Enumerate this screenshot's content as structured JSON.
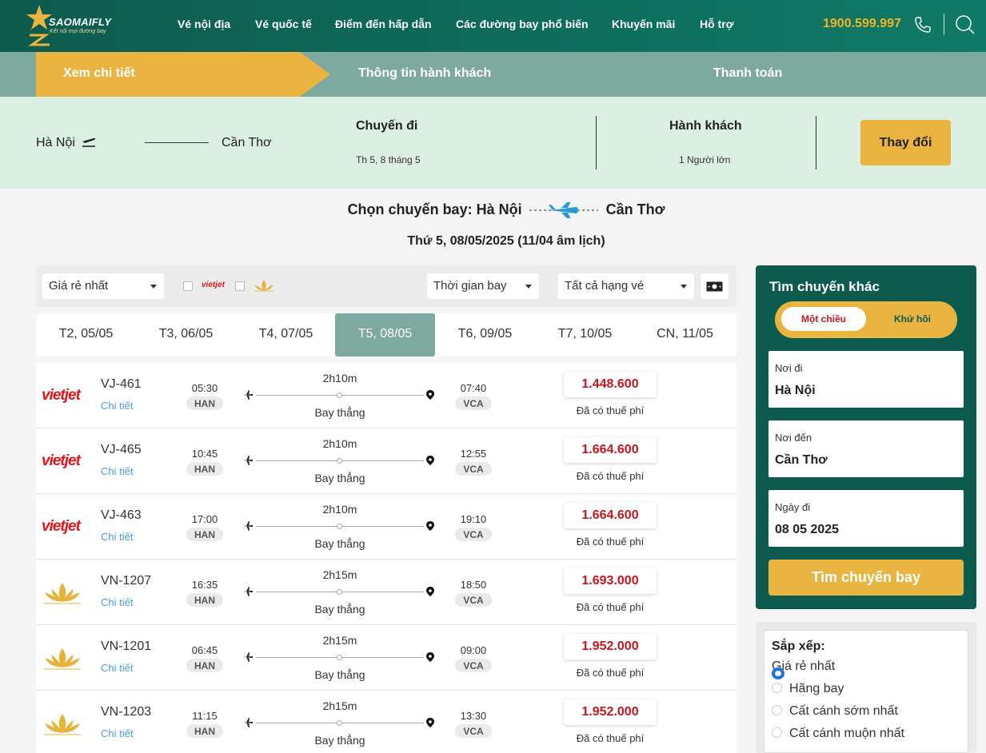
{
  "header": {
    "brand": "SAOMAIFLY",
    "slogan": "Kết nối mọi đường bay",
    "nav": [
      "Vé nội địa",
      "Vé quốc tế",
      "Điểm đến hấp dẫn",
      "Các đường bay phổ biến",
      "Khuyến mãi",
      "Hỗ trợ"
    ],
    "hotline": "1900.599.997"
  },
  "steps": [
    "Xem chi tiết",
    "Thông tin hành khách",
    "Thanh toán"
  ],
  "summary": {
    "from": "Hà Nội",
    "to": "Cần Thơ",
    "trip_label": "Chuyến đi",
    "trip_date": "Th 5, 8 tháng 5",
    "pax_label": "Hành khách",
    "pax_value": "1 Người lớn",
    "change_button": "Thay đổi"
  },
  "route_title": {
    "prefix": "Chọn chuyến bay: Hà Nội",
    "to": "Cần Thơ"
  },
  "date_title": "Thứ 5, 08/05/2025 (11/04 âm lịch)",
  "filters": {
    "sort_select": "Giá rẻ nhất",
    "airline_vietjet": "vietjet",
    "time_select": "Thời gian bay",
    "class_select": "Tất cả hạng vé"
  },
  "dates": [
    "T2, 05/05",
    "T3, 06/05",
    "T4, 07/05",
    "T5, 08/05",
    "T6, 09/05",
    "T7, 10/05",
    "CN, 11/05"
  ],
  "flights": [
    {
      "airline": "vietjet",
      "code": "VJ-461",
      "detail": "Chi tiết",
      "dep": "05:30",
      "from": "HAN",
      "dur": "2h10m",
      "type": "Bay thẳng",
      "arr": "07:40",
      "to": "VCA",
      "price": "1.448.600",
      "tax": "Đã có thuế phí"
    },
    {
      "airline": "vietjet",
      "code": "VJ-465",
      "detail": "Chi tiết",
      "dep": "10:45",
      "from": "HAN",
      "dur": "2h10m",
      "type": "Bay thẳng",
      "arr": "12:55",
      "to": "VCA",
      "price": "1.664.600",
      "tax": "Đã có thuế phí"
    },
    {
      "airline": "vietjet",
      "code": "VJ-463",
      "detail": "Chi tiết",
      "dep": "17:00",
      "from": "HAN",
      "dur": "2h10m",
      "type": "Bay thẳng",
      "arr": "19:10",
      "to": "VCA",
      "price": "1.664.600",
      "tax": "Đã có thuế phí"
    },
    {
      "airline": "vietnam-airlines",
      "code": "VN-1207",
      "detail": "Chi tiết",
      "dep": "16:35",
      "from": "HAN",
      "dur": "2h15m",
      "type": "Bay thẳng",
      "arr": "18:50",
      "to": "VCA",
      "price": "1.693.000",
      "tax": "Đã có thuế phí"
    },
    {
      "airline": "vietnam-airlines",
      "code": "VN-1201",
      "detail": "Chi tiết",
      "dep": "06:45",
      "from": "HAN",
      "dur": "2h15m",
      "type": "Bay thẳng",
      "arr": "09:00",
      "to": "VCA",
      "price": "1.952.000",
      "tax": "Đã có thuế phí"
    },
    {
      "airline": "vietnam-airlines",
      "code": "VN-1203",
      "detail": "Chi tiết",
      "dep": "11:15",
      "from": "HAN",
      "dur": "2h15m",
      "type": "Bay thẳng",
      "arr": "13:30",
      "to": "VCA",
      "price": "1.952.000",
      "tax": "Đã có thuế phí"
    }
  ],
  "sidebar": {
    "title": "Tìm chuyến khác",
    "one_way": "Một chiều",
    "round_trip": "Khứ hồi",
    "from_label": "Nơi đi",
    "from_value": "Hà Nội",
    "to_label": "Nơi đến",
    "to_value": "Cần Thơ",
    "date_label": "Ngày đi",
    "date_value": "08 05 2025",
    "search_button": "Tìm chuyến bay"
  },
  "sort": {
    "title": "Sắp xếp:",
    "options": [
      "Giá rẻ nhất",
      "Hãng bay",
      "Cất cánh sớm nhất",
      "Cất cánh muộn nhất"
    ]
  },
  "colors": {
    "primary": "#0d5b4e",
    "accent": "#e9b440",
    "price": "#c8161d"
  }
}
